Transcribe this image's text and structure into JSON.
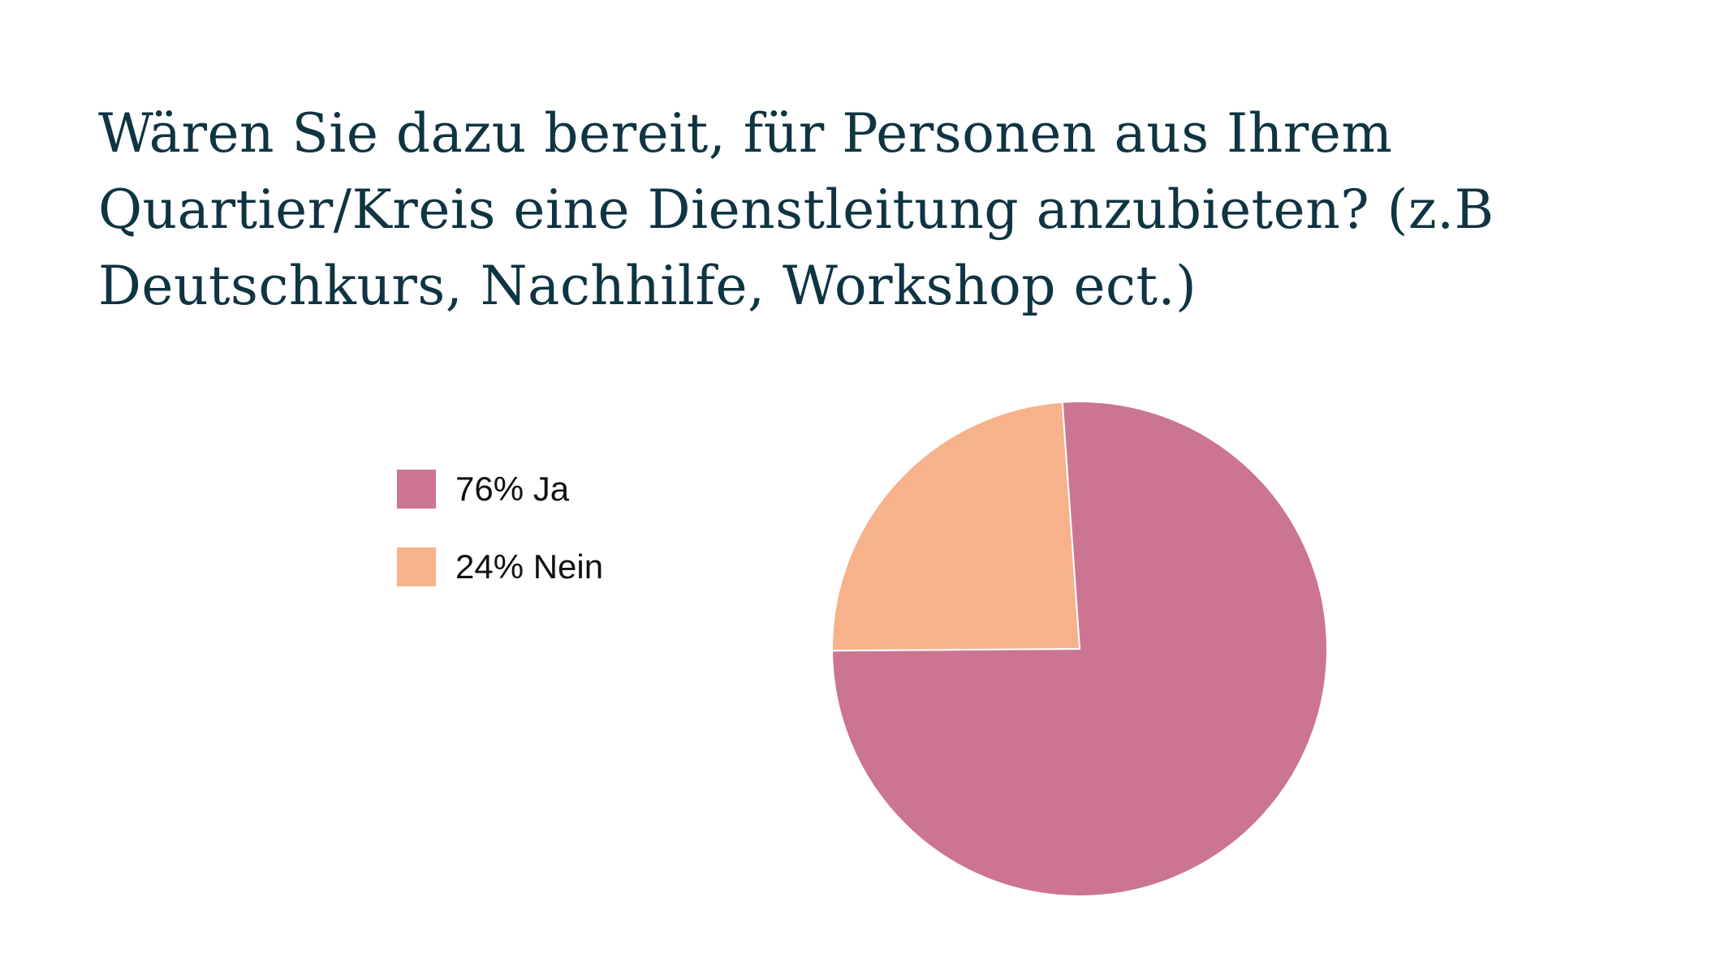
{
  "slide": {
    "title": "Wären Sie dazu bereit, für Personen aus Ihrem Quartier/Kreis eine Dienstleitung anzubieten? (z.B Deutschkurs, Nachhilfe, Workshop ect.)"
  },
  "chart_data": {
    "type": "pie",
    "title": "Wären Sie dazu bereit, für Personen aus Ihrem Quartier/Kreis eine Dienstleitung anzubieten? (z.B Deutschkurs, Nachhilfe, Workshop ect.)",
    "categories": [
      "Ja",
      "Nein"
    ],
    "values": [
      76,
      24
    ],
    "legend_labels": [
      "76% Ja",
      "24% Nein"
    ],
    "colors": [
      "#cc7592",
      "#f7b28b"
    ],
    "legend_position": "left"
  }
}
